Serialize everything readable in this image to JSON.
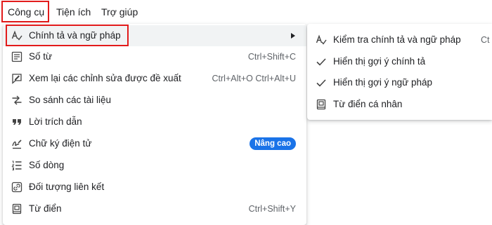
{
  "menubar": {
    "items": [
      {
        "label": "Công cụ"
      },
      {
        "label": "Tiện ích"
      },
      {
        "label": "Trợ giúp"
      }
    ]
  },
  "tools_menu": {
    "items": [
      {
        "label": "Chính tả và ngữ pháp",
        "shortcut": "",
        "icon": "spellcheck-icon",
        "has_submenu": true
      },
      {
        "label": "Số từ",
        "shortcut": "Ctrl+Shift+C",
        "icon": "word-count-icon"
      },
      {
        "label": "Xem lại các chỉnh sửa được đề xuất",
        "shortcut": "Ctrl+Alt+O Ctrl+Alt+U",
        "icon": "review-edits-icon"
      },
      {
        "label": "So sánh các tài liệu",
        "shortcut": "",
        "icon": "compare-icon"
      },
      {
        "label": "Lời trích dẫn",
        "shortcut": "",
        "icon": "quote-icon"
      },
      {
        "label": "Chữ ký điện tử",
        "shortcut": "",
        "icon": "signature-icon",
        "badge": "Nâng cao"
      },
      {
        "label": "Số dòng",
        "shortcut": "",
        "icon": "line-numbers-icon"
      },
      {
        "label": "Đối tượng liên kết",
        "shortcut": "",
        "icon": "linked-objects-icon"
      },
      {
        "label": "Từ điển",
        "shortcut": "Ctrl+Shift+Y",
        "icon": "dictionary-icon"
      }
    ]
  },
  "spelling_submenu": {
    "items": [
      {
        "label": "Kiểm tra chính tả và ngữ pháp",
        "shortcut": "Ct",
        "icon": "spellcheck-icon"
      },
      {
        "label": "Hiển thị gợi ý chính tả",
        "icon": "check-icon",
        "checked": true
      },
      {
        "label": "Hiển thị gợi ý ngữ pháp",
        "icon": "check-icon",
        "checked": true
      },
      {
        "label": "Từ điển cá nhân",
        "icon": "personal-dictionary-icon"
      }
    ]
  },
  "colors": {
    "highlight": "#e21b1b",
    "badge": "#1a73e8",
    "hover": "#f1f3f4"
  }
}
